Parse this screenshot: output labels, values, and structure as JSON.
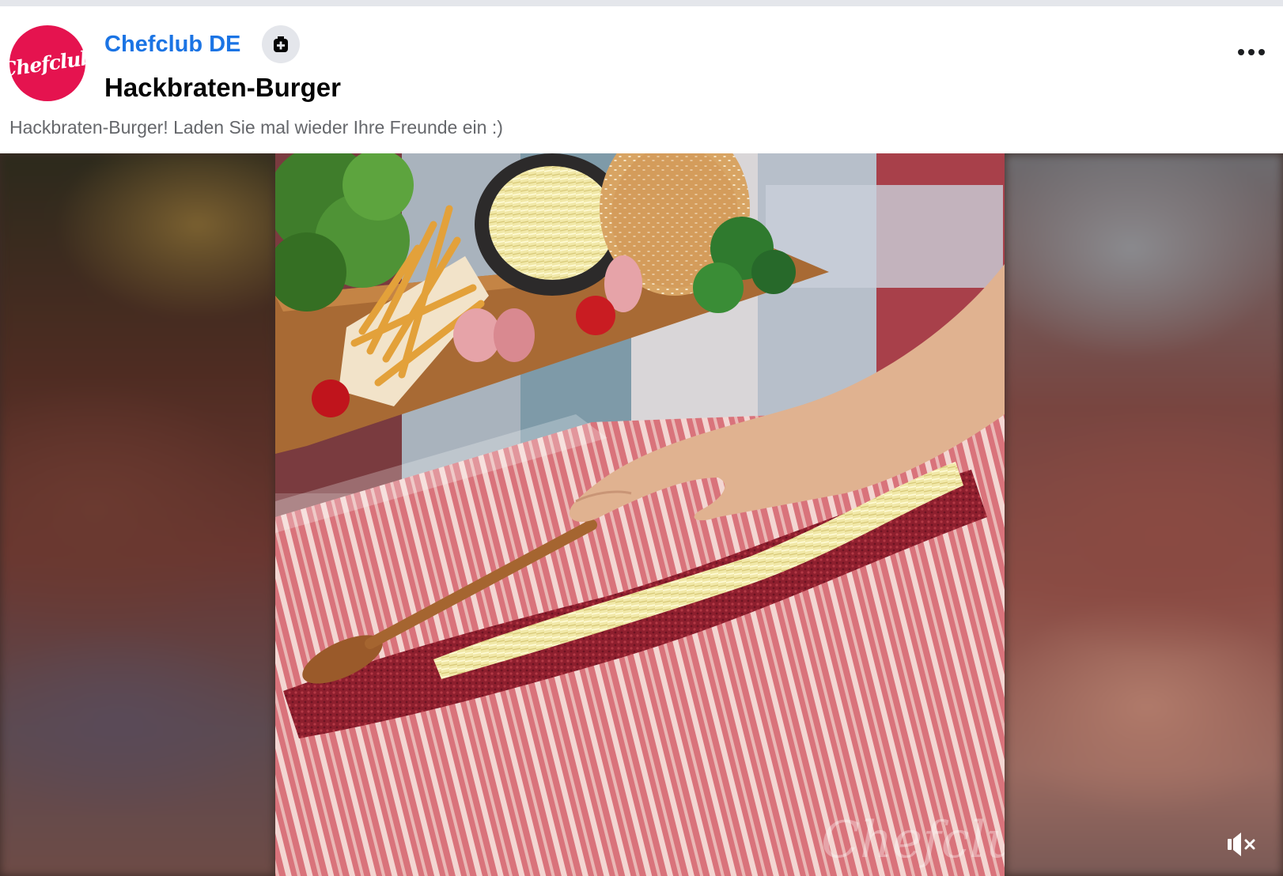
{
  "post": {
    "page_name": "Chefclub DE",
    "avatar_text": "Chefclub",
    "title": "Hackbraten-Burger",
    "description": "Hackbraten-Burger! Laden Sie mal wieder Ihre Freunde ein :)"
  },
  "icons": {
    "follow": "add-page-icon",
    "more": "more-options-icon",
    "sound": "muted-speaker-icon"
  },
  "video": {
    "watermark": "Chefclub",
    "muted": true
  },
  "colors": {
    "brand": "#e5134f",
    "link": "#1b74e4",
    "text_primary": "#050505",
    "text_secondary": "#65676b"
  }
}
